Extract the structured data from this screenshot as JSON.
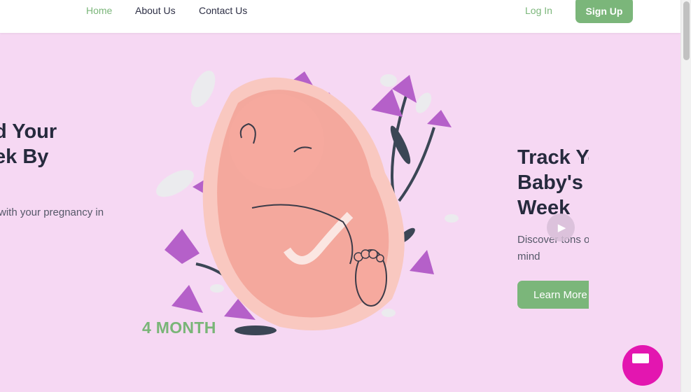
{
  "nav": {
    "home": "Home",
    "about": "About Us",
    "contact": "Contact Us",
    "login": "Log In",
    "signup": "Sign Up"
  },
  "previous_slide": {
    "title": "d Your\nek By",
    "description": "with your pregnancy in"
  },
  "slide": {
    "month": "4 MONTH",
    "title": "Track Your\nBaby's Growth\nWeek",
    "description": "Discover tons of\nmind",
    "button": "Learn More"
  },
  "colors": {
    "accent": "#7bb67a",
    "hero_bg": "#f6d8f3",
    "chat": "#e316b0"
  },
  "icons": {
    "next": "chevron-right-icon",
    "chat": "chat-icon"
  }
}
